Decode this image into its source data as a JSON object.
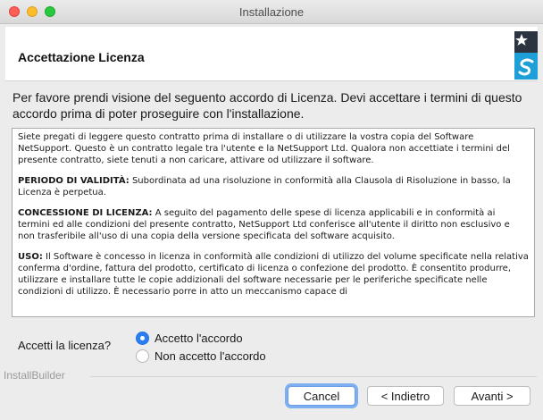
{
  "window": {
    "title": "Installazione"
  },
  "header": {
    "title": "Accettazione Licenza",
    "logo_icon": "netsupport-logo"
  },
  "intro": "Per favore prendi visione del seguento accordo di Licenza. Devi accettare i termini di questo accordo prima di poter proseguire con l'installazione.",
  "license": {
    "p1": "Siete pregati di leggere questo contratto prima di installare o di utilizzare la vostra copia del Software NetSupport. Questo è un contratto legale tra l'utente e la NetSupport Ltd. Qualora non accettiate i termini del presente contratto, siete tenuti a non caricare, attivare od utilizzare il software.",
    "p2_heading": "PERIODO DI VALIDITÀ:",
    "p2_text": " Subordinata ad una risoluzione in conformità alla Clausola di Risoluzione in basso, la Licenza è perpetua.",
    "p3_heading": "CONCESSIONE DI LICENZA:",
    "p3_text": " A seguito del pagamento delle spese di licenza applicabili e in conformità ai termini ed alle condizioni del presente contratto, NetSupport Ltd conferisce all'utente il diritto non esclusivo e non trasferibile all'uso di una copia della versione specificata del software acquisito.",
    "p4_heading": "USO:",
    "p4_text": " Il Software è concesso in licenza in conformità alle condizioni di utilizzo del volume specificate nella relativa conferma d'ordine, fattura del prodotto, certificato di licenza o confezione del prodotto. È consentito produrre, utilizzare e installare tutte le copie addizionali del software necessarie per le periferiche specificate nelle condizioni di utilizzo. È necessario porre in atto un meccanismo capace di"
  },
  "question": "Accetti la licenza?",
  "options": [
    {
      "label": "Accetto l'accordo",
      "checked": true
    },
    {
      "label": "Non accetto l'accordo",
      "checked": false
    }
  ],
  "footer": {
    "brand": "InstallBuilder",
    "cancel_label": "Cancel",
    "back_label": "< Indietro",
    "next_label": "Avanti >"
  }
}
